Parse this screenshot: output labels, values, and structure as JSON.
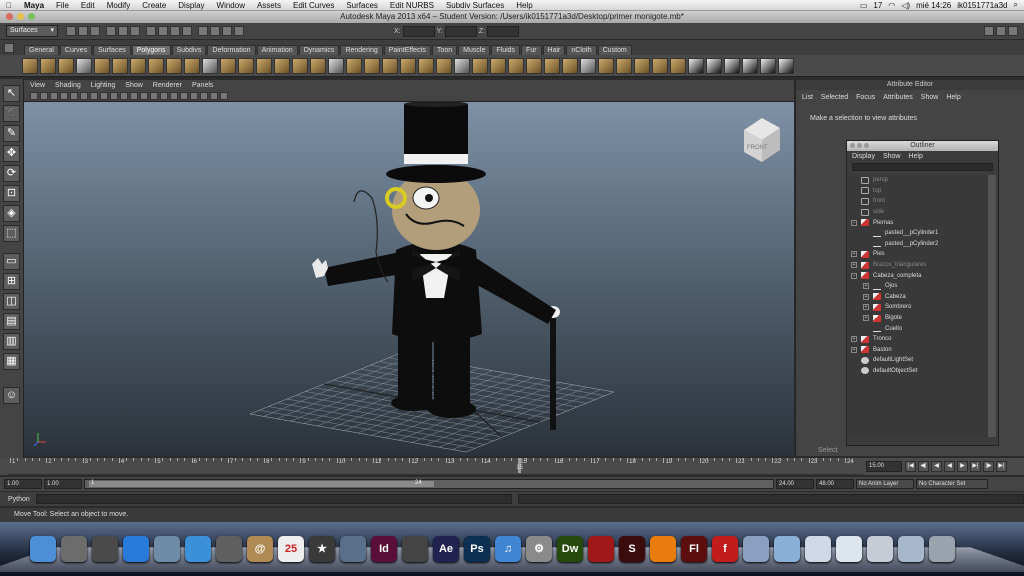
{
  "macbar": {
    "apple": "",
    "app": "Maya",
    "menus": [
      "File",
      "Edit",
      "Modify",
      "Create",
      "Display",
      "Window",
      "Assets",
      "Edit Curves",
      "Surfaces",
      "Edit NURBS",
      "Subdiv Surfaces",
      "Help"
    ],
    "battery": "17",
    "clock": "mié 14:26",
    "user": "ik0151771a3d"
  },
  "window": {
    "title": "Autodesk Maya 2013 x64 – Student Version: /Users/ik0151771a3d/Desktop/primer monigote.mb*"
  },
  "statusline": {
    "menuset": "Surfaces",
    "x_label": "X:",
    "y_label": "Y:",
    "z_label": "Z:"
  },
  "shelf_tabs": [
    "General",
    "Curves",
    "Surfaces",
    "Polygons",
    "Subdivs",
    "Deformation",
    "Animation",
    "Dynamics",
    "Rendering",
    "PaintEffects",
    "Toon",
    "Muscle",
    "Fluids",
    "Fur",
    "Hair",
    "nCloth",
    "Custom"
  ],
  "shelf_active": "Polygons",
  "panel": {
    "menus": [
      "View",
      "Shading",
      "Lighting",
      "Show",
      "Renderer",
      "Panels"
    ],
    "viewcube_label": "FRONT"
  },
  "attribute_editor": {
    "title": "Attribute Editor",
    "menus": [
      "List",
      "Selected",
      "Focus",
      "Attributes",
      "Show",
      "Help"
    ],
    "message": "Make a selection to view attributes",
    "select_label": "Select"
  },
  "outliner": {
    "title": "Outliner",
    "menus": [
      "Display",
      "Show",
      "Help"
    ],
    "items": [
      {
        "label": "persp",
        "icon": "camera-icon",
        "dim": true,
        "exp": false,
        "indent": 0
      },
      {
        "label": "top",
        "icon": "camera-icon",
        "dim": true,
        "exp": false,
        "indent": 0
      },
      {
        "label": "front",
        "icon": "camera-icon",
        "dim": true,
        "exp": false,
        "indent": 0
      },
      {
        "label": "side",
        "icon": "camera-icon",
        "dim": true,
        "exp": false,
        "indent": 0
      },
      {
        "label": "Piernas",
        "icon": "group-icon",
        "dim": false,
        "exp": "−",
        "indent": 0
      },
      {
        "label": "pasted__pCylinder1",
        "icon": "curve-icon",
        "dim": false,
        "exp": false,
        "indent": 1
      },
      {
        "label": "pasted__pCylinder2",
        "icon": "curve-icon",
        "dim": false,
        "exp": false,
        "indent": 1
      },
      {
        "label": "Pies",
        "icon": "group-icon",
        "dim": false,
        "exp": "+",
        "indent": 0
      },
      {
        "label": "Brazos_triangulares",
        "icon": "group-icon",
        "dim": true,
        "exp": "+",
        "indent": 0
      },
      {
        "label": "Cabeza_completa",
        "icon": "group-icon",
        "dim": false,
        "exp": "−",
        "indent": 0
      },
      {
        "label": "Ojos",
        "icon": "curve-icon",
        "dim": false,
        "exp": "+",
        "indent": 1
      },
      {
        "label": "Cabeza",
        "icon": "group-icon",
        "dim": false,
        "exp": "+",
        "indent": 1
      },
      {
        "label": "Sombrero",
        "icon": "group-icon",
        "dim": false,
        "exp": "+",
        "indent": 1
      },
      {
        "label": "Bigote",
        "icon": "group-icon",
        "dim": false,
        "exp": "+",
        "indent": 1
      },
      {
        "label": "Cuello",
        "icon": "curve-icon",
        "dim": false,
        "exp": false,
        "indent": 1
      },
      {
        "label": "Tronco",
        "icon": "group-icon",
        "dim": false,
        "exp": "+",
        "indent": 0
      },
      {
        "label": "Baston",
        "icon": "group-icon",
        "dim": false,
        "exp": "+",
        "indent": 0
      },
      {
        "label": "defaultLightSet",
        "icon": "set-icon",
        "dim": false,
        "exp": false,
        "indent": 0
      },
      {
        "label": "defaultObjectSet",
        "icon": "set-icon",
        "dim": false,
        "exp": false,
        "indent": 0
      }
    ]
  },
  "timeline": {
    "ticks": [
      "1",
      "2",
      "3",
      "4",
      "5",
      "6",
      "7",
      "8",
      "9",
      "10",
      "11",
      "12",
      "13",
      "14",
      "15",
      "16",
      "17",
      "18",
      "19",
      "20",
      "21",
      "22",
      "23",
      "24"
    ],
    "current_marker": "15",
    "current_frame": "15.00"
  },
  "range": {
    "start": "1.00",
    "inner_start": "1.00",
    "left_label": "1",
    "mid_label": "24",
    "end": "24.00",
    "outer_end": "48.00",
    "anim_layer": "No Anim Layer",
    "char_set": "No Character Set"
  },
  "cmdline": {
    "label": "Python"
  },
  "helpline": {
    "text": "Move Tool: Select an object to move."
  },
  "dock": {
    "apps": [
      {
        "name": "finder",
        "color": "#4d8fd6",
        "text": ""
      },
      {
        "name": "launchpad",
        "color": "#6c6c6c",
        "text": ""
      },
      {
        "name": "mission-control",
        "color": "#4a4a4a",
        "text": ""
      },
      {
        "name": "app-store",
        "color": "#2a7ad9",
        "text": ""
      },
      {
        "name": "preview",
        "color": "#6e8ba8",
        "text": ""
      },
      {
        "name": "safari",
        "color": "#3b90d8",
        "text": ""
      },
      {
        "name": "facetime",
        "color": "#5f5f5f",
        "text": ""
      },
      {
        "name": "contacts",
        "color": "#b08a55",
        "text": "@"
      },
      {
        "name": "calendar",
        "color": "#eeeeee",
        "text": "25"
      },
      {
        "name": "imovie",
        "color": "#3a3a3a",
        "text": "★"
      },
      {
        "name": "iphoto",
        "color": "#59708a",
        "text": ""
      },
      {
        "name": "indesign",
        "color": "#5a0e3a",
        "text": "Id"
      },
      {
        "name": "ink",
        "color": "#444444",
        "text": ""
      },
      {
        "name": "after-effects",
        "color": "#222250",
        "text": "Ae"
      },
      {
        "name": "photoshop",
        "color": "#0c2f52",
        "text": "Ps"
      },
      {
        "name": "itunes",
        "color": "#3f85d1",
        "text": "♫"
      },
      {
        "name": "system-preferences",
        "color": "#8a8a8a",
        "text": "⚙"
      },
      {
        "name": "dreamweaver",
        "color": "#254a0c",
        "text": "Dw"
      },
      {
        "name": "photo-booth",
        "color": "#a01818",
        "text": ""
      },
      {
        "name": "stylus",
        "color": "#3a0c0c",
        "text": "S"
      },
      {
        "name": "blender",
        "color": "#e87d0d",
        "text": ""
      },
      {
        "name": "flash",
        "color": "#5c0e0e",
        "text": "Fl"
      },
      {
        "name": "flash-player",
        "color": "#c21c1c",
        "text": "f"
      },
      {
        "name": "utilities",
        "color": "#8aa0c0",
        "text": ""
      },
      {
        "name": "folder",
        "color": "#8bb0d8",
        "text": ""
      },
      {
        "name": "documents",
        "color": "#cfd8e6",
        "text": ""
      },
      {
        "name": "downloads",
        "color": "#dde5ee",
        "text": ""
      },
      {
        "name": "files",
        "color": "#c6ccd6",
        "text": ""
      },
      {
        "name": "finder-window",
        "color": "#a8b8cc",
        "text": ""
      },
      {
        "name": "trash",
        "color": "#9aa3ad",
        "text": ""
      }
    ]
  }
}
